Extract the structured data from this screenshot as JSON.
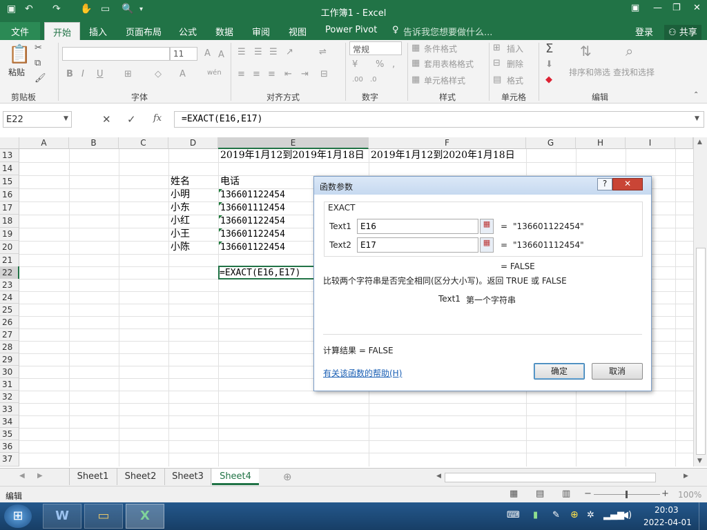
{
  "window": {
    "title": "工作簿1 - Excel"
  },
  "quick_access": {
    "save_icon": "save-icon",
    "undo_icon": "undo-icon",
    "redo_icon": "redo-icon"
  },
  "tabs": [
    "文件",
    "开始",
    "插入",
    "页面布局",
    "公式",
    "数据",
    "审阅",
    "视图",
    "Power Pivot"
  ],
  "tell_me": "告诉我您想要做什么...",
  "account": {
    "login": "登录",
    "share": "共享"
  },
  "ribbon": {
    "groups": [
      "剪贴板",
      "字体",
      "对齐方式",
      "数字",
      "样式",
      "单元格",
      "编辑"
    ],
    "paste": "粘贴",
    "font_size": "11",
    "number_format": "常规",
    "styles": [
      "条件格式",
      "套用表格格式",
      "单元格样式"
    ],
    "cells": [
      "插入",
      "删除",
      "格式"
    ],
    "edit": [
      "排序和筛选",
      "查找和选择"
    ]
  },
  "formula_bar": {
    "name_box": "E22",
    "formula": "=EXACT(E16,E17)",
    "fx": "fx"
  },
  "columns": [
    "A",
    "B",
    "C",
    "D",
    "E",
    "F",
    "G",
    "H",
    "I"
  ],
  "rows": [
    "13",
    "14",
    "15",
    "16",
    "17",
    "18",
    "19",
    "20",
    "21",
    "22",
    "23",
    "24",
    "25",
    "26",
    "27",
    "28",
    "29",
    "30",
    "31",
    "32",
    "33",
    "34",
    "35",
    "36",
    "37"
  ],
  "cells": {
    "E13": "2019年1月12到2019年1月18日",
    "F13": "2019年1月12到2020年1月18日",
    "D15": "姓名",
    "E15": "电话",
    "D16": "小明",
    "E16": "136601122454",
    "D17": "小东",
    "E17": "136601112454",
    "D18": "小红",
    "E18": "136601122454",
    "D19": "小王",
    "E19": "136601122454",
    "D20": "小陈",
    "E20": "136601122454",
    "E22": "=EXACT(E16,E17)"
  },
  "dialog": {
    "title": "函数参数",
    "help_glyph": "?",
    "function_name": "EXACT",
    "arg1_label": "Text1",
    "arg1_value": "E16",
    "arg1_result": "\"136601122454\"",
    "arg2_label": "Text2",
    "arg2_value": "E17",
    "arg2_result": "\"136601112454\"",
    "equals": "=",
    "result_line": "=  FALSE",
    "description": "比较两个字符串是否完全相同(区分大小写)。返回 TRUE 或 FALSE",
    "arg_help_name": "Text1",
    "arg_help_text": "第一个字符串",
    "calc_result": "计算结果 =   FALSE",
    "help_link": "有关该函数的帮助(H)",
    "ok": "确定",
    "cancel": "取消"
  },
  "sheets": [
    "Sheet1",
    "Sheet2",
    "Sheet3",
    "Sheet4"
  ],
  "active_sheet": "Sheet4",
  "status": {
    "mode": "编辑",
    "zoom": "100%"
  },
  "taskbar": {
    "time": "20:03",
    "date": "2022-04-01"
  },
  "colors": {
    "excel_green": "#217346",
    "selection": "#1e7a3a"
  }
}
